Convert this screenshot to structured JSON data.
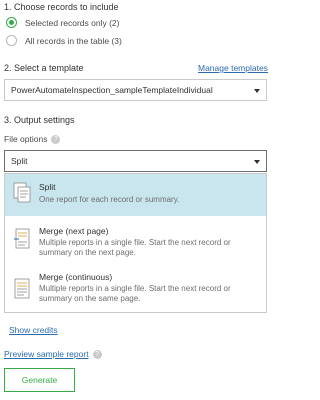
{
  "step1": {
    "title": "1. Choose records to include",
    "options": [
      {
        "label": "Selected records only (2)",
        "selected": true
      },
      {
        "label": "All records in the table (3)",
        "selected": false
      }
    ]
  },
  "step2": {
    "title": "2. Select a template",
    "manage_link": "Manage templates",
    "template_value": "PowerAutomateInspection_sampleTemplateIndividual"
  },
  "step3": {
    "title": "3. Output settings",
    "file_options_label": "File options",
    "file_options_value": "Split",
    "options": [
      {
        "title": "Split",
        "desc": "One report for each record or summary.",
        "active": true
      },
      {
        "title": "Merge (next page)",
        "desc": "Multiple reports in a single file. Start the next record or summary on the next page.",
        "active": false
      },
      {
        "title": "Merge (continuous)",
        "desc": "Multiple reports in a single file. Start the next record or summary on the same page.",
        "active": false
      }
    ]
  },
  "links": {
    "show_credits": "Show credits",
    "preview_sample": "Preview sample report"
  },
  "generate_label": "Generate",
  "colors": {
    "accent_green": "#35ac46",
    "link_blue": "#2a6cae",
    "highlight": "#c9e6ee"
  }
}
